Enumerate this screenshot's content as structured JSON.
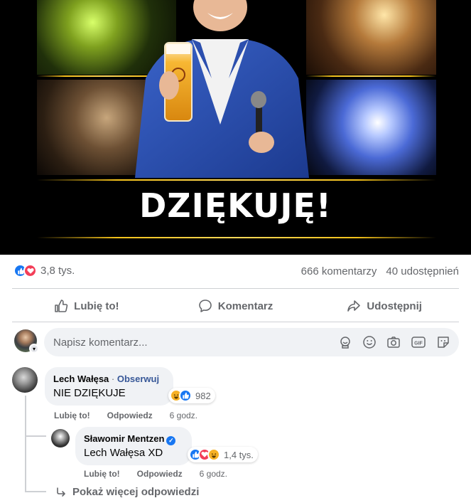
{
  "post": {
    "image_headline": "DZIĘKUJĘ!",
    "reaction_count": "3,8 tys.",
    "comments_count": "666 komentarzy",
    "shares_count": "40 udostępnień"
  },
  "actions": {
    "like": "Lubię to!",
    "comment": "Komentarz",
    "share": "Udostępnij"
  },
  "composer": {
    "placeholder": "Napisz komentarz..."
  },
  "comments": [
    {
      "author": "Lech Wałęsa",
      "follow": "Obserwuj",
      "text": "NIE DZIĘKUJE",
      "reaction_count": "982",
      "like": "Lubię to!",
      "reply": "Odpowiedz",
      "time": "6 godz."
    }
  ],
  "reply": {
    "author": "Sławomir Mentzen",
    "text": "Lech Wałęsa XD",
    "reaction_count": "1,4 tys.",
    "like": "Lubię to!",
    "reply": "Odpowiedz",
    "time": "6 godz."
  },
  "more_replies": "Pokaż więcej odpowiedzi",
  "colors": {
    "like_blue": "#1877f2",
    "love_red": "#f33e58",
    "haha_yellow": "#f7b125",
    "gold": "#f5c21a"
  }
}
